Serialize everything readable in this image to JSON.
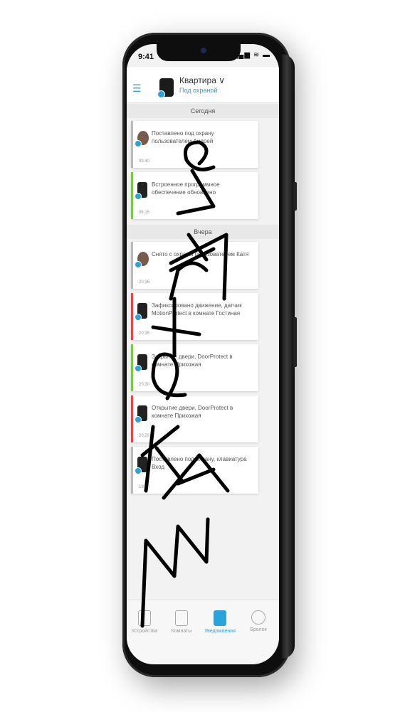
{
  "status": {
    "time": "9:41",
    "icons": "▂▄▆ ≋ ▬"
  },
  "header": {
    "title": "Квартира ∨",
    "subtitle": "Под охраной"
  },
  "sections": {
    "today": "Сегодня",
    "yesterday": "Вчера"
  },
  "events": [
    {
      "text": "Поставлено под охрану пользователем Андрей",
      "time": "09:40",
      "accent": "#bbbbbb",
      "icon": "person-avatar-icon"
    },
    {
      "text": "Встроенное программное обеспечение обновлено",
      "time": "06:15",
      "accent": "#7ac943",
      "icon": "hub-device-icon"
    },
    {
      "text": "Снято с охраны пользователем Катя",
      "time": "20:36",
      "accent": "#bbbbbb",
      "icon": "person-avatar-icon"
    },
    {
      "text": "Зафиксировано движение, датчик MotionProtect в комнате Гостиная",
      "time": "20:35",
      "accent": "#e04848",
      "icon": "motion-sensor-icon"
    },
    {
      "text": "Закрытие двери, DoorProtect в комнате Прихожая",
      "time": "20:30",
      "accent": "#7ac943",
      "icon": "door-sensor-icon"
    },
    {
      "text": "Открытие двери, DoorProtect в комнате Прихожая",
      "time": "20:29",
      "accent": "#e04848",
      "icon": "door-sensor-icon"
    },
    {
      "text": "Поставлено под охрану, клавиатура Вход",
      "time": "19:10",
      "accent": "#bbbbbb",
      "icon": "keypad-icon"
    }
  ],
  "tabs": [
    {
      "label": "Устройства",
      "icon": "devices-icon"
    },
    {
      "label": "Комнаты",
      "icon": "rooms-icon"
    },
    {
      "label": "Уведомления",
      "icon": "notifications-icon"
    },
    {
      "label": "Брелок",
      "icon": "keyfob-icon"
    }
  ],
  "watermark": {
    "text": "MAKETRAVEL"
  },
  "colors": {
    "accent": "#29a3d9",
    "phone_body": "#0e0e0e"
  }
}
